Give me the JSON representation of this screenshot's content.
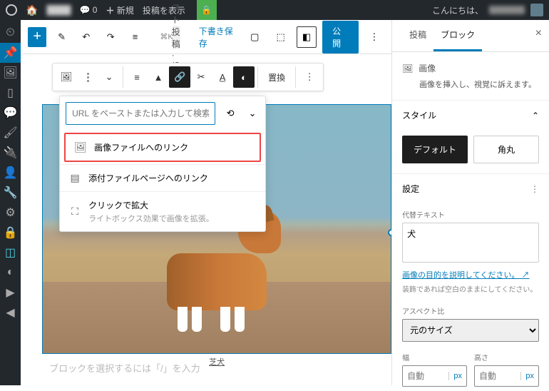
{
  "adminbar": {
    "comments_count": "0",
    "new_label": "新規",
    "view_post": "投稿を表示",
    "greeting": "こんにちは、"
  },
  "topbar": {
    "title": "テスト投稿 · 投稿",
    "cmdk": "⌘K",
    "draft_save": "下書き保存",
    "publish": "公開"
  },
  "blocktoolbar": {
    "replace": "置換"
  },
  "linkpop": {
    "placeholder": "URL をペーストまたは入力して検索",
    "opt1": "画像ファイルへのリンク",
    "opt2": "添付ファイルページへのリンク",
    "opt3": "クリックで拡大",
    "opt3_sub": "ライトボックス効果で画像を拡張。"
  },
  "image": {
    "caption": "芝犬"
  },
  "placeholder_text": "ブロックを選択するには「/」を入力",
  "sidebar": {
    "tab_post": "投稿",
    "tab_block": "ブロック",
    "block_name": "画像",
    "block_desc": "画像を挿入し、視覚に訴えます。",
    "style_hdr": "スタイル",
    "style_default": "デフォルト",
    "style_rounded": "角丸",
    "settings_hdr": "設定",
    "alt_label": "代替テキスト",
    "alt_value": "犬",
    "alt_link": "画像の目的を説明してください。",
    "alt_help": "装飾であれば空白のままにしてください。",
    "aspect_label": "アスペクト比",
    "aspect_value": "元のサイズ",
    "width_label": "幅",
    "height_label": "高さ",
    "dim_auto": "自動",
    "dim_unit": "px"
  }
}
